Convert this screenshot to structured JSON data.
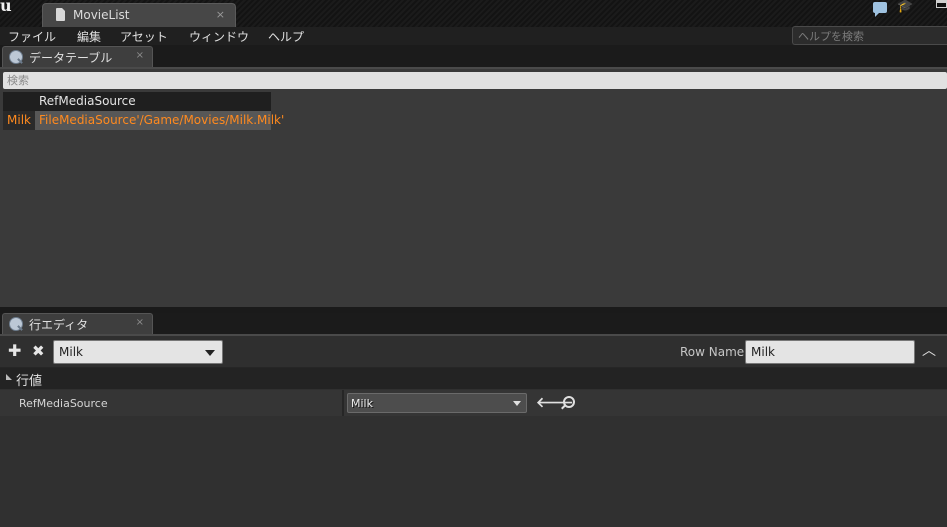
{
  "window": {
    "tab_title": "MovieList",
    "tab_close": "×",
    "help_search_placeholder": "ヘルプを検索"
  },
  "menu": {
    "items": [
      "ファイル",
      "編集",
      "アセット",
      "ウィンドウ",
      "ヘルプ"
    ]
  },
  "data_table_panel": {
    "tab_label": "データテーブル",
    "tab_close": "×",
    "search_placeholder": "検索",
    "columns": [
      "RefMediaSource"
    ],
    "rows": [
      {
        "key": "Milk",
        "RefMediaSource": "FileMediaSource'/Game/Movies/Milk.Milk'"
      }
    ]
  },
  "row_editor_panel": {
    "tab_label": "行エディタ",
    "tab_close": "×",
    "selected_row": "Milk",
    "row_name_label": "Row Name:",
    "row_name_value": "Milk",
    "category": "行値",
    "properties": [
      {
        "name": "RefMediaSource",
        "value": "Milk"
      }
    ]
  },
  "icons": {
    "add": "plus-icon",
    "remove": "delete-icon",
    "use_selected": "arrow-left-icon",
    "browse": "magnifier-icon"
  },
  "colors": {
    "accent_orange": "#ff8a1f",
    "background": "#3a3a3a"
  }
}
